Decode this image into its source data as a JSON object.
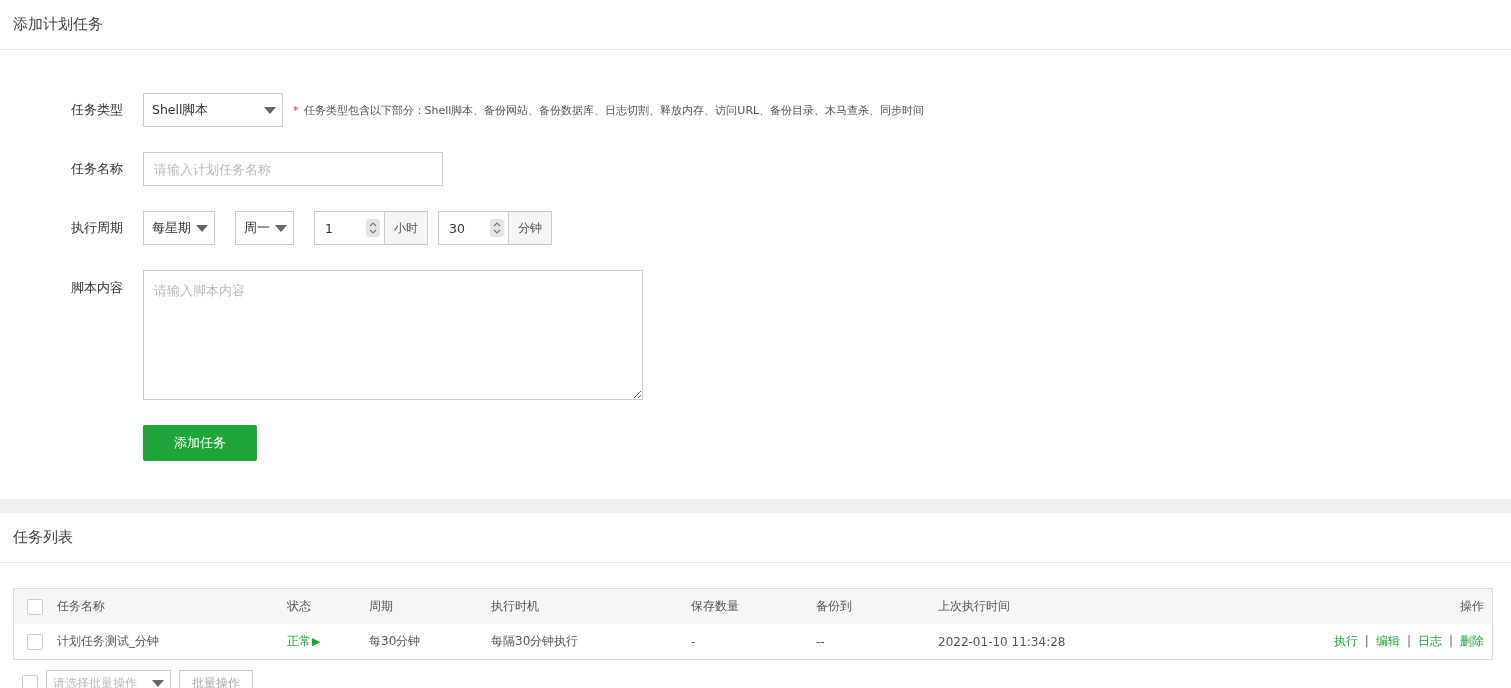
{
  "form_panel": {
    "title": "添加计划任务",
    "task_type": {
      "label": "任务类型",
      "value": "Shell脚本",
      "required_mark": "*",
      "hint": "任务类型包含以下部分：Shell脚本、备份网站、备份数据库、日志切割、释放内存、访问URL、备份目录、木马查杀、同步时间"
    },
    "task_name": {
      "label": "任务名称",
      "placeholder": "请输入计划任务名称"
    },
    "period": {
      "label": "执行周期",
      "cycle": "每星期",
      "weekday": "周一",
      "hour": "1",
      "hour_unit": "小时",
      "minute": "30",
      "minute_unit": "分钟"
    },
    "script": {
      "label": "脚本内容",
      "placeholder": "请输入脚本内容"
    },
    "submit_button": "添加任务"
  },
  "list_panel": {
    "title": "任务列表",
    "table": {
      "select_all_checked": false,
      "columns": [
        "任务名称",
        "状态",
        "周期",
        "执行时机",
        "保存数量",
        "备份到",
        "上次执行时间",
        "操作"
      ],
      "rows": [
        {
          "checked": false,
          "name": "计划任务测试_分钟",
          "status": "正常",
          "status_icon": "▶",
          "period": "每30分钟",
          "timing": "每隔30分钟执行",
          "keep": "-",
          "backup_to": "--",
          "last_run": "2022-01-10 11:34:28",
          "actions": [
            "执行",
            "编辑",
            "日志",
            "删除"
          ],
          "action_separator": "|"
        }
      ]
    },
    "batch": {
      "checked": false,
      "placeholder": "请选择批量操作",
      "button": "批量操作"
    }
  }
}
